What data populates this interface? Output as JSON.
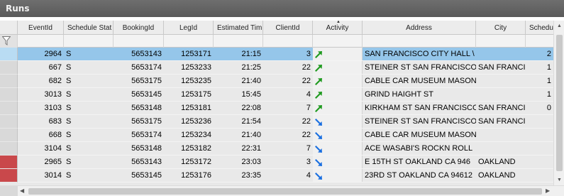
{
  "window": {
    "title": "Runs"
  },
  "columns": [
    {
      "key": "eventid",
      "label": "EventId"
    },
    {
      "key": "status",
      "label": "Schedule Stat"
    },
    {
      "key": "booking",
      "label": "BookingId"
    },
    {
      "key": "leg",
      "label": "LegId"
    },
    {
      "key": "time",
      "label": "Estimated Tim"
    },
    {
      "key": "client",
      "label": "ClientId"
    },
    {
      "key": "activity",
      "label": "Activity"
    },
    {
      "key": "address",
      "label": "Address"
    },
    {
      "key": "city",
      "label": "City"
    },
    {
      "key": "sched",
      "label": "Schedu"
    }
  ],
  "colors": {
    "pickup_arrow": "#1f9a1f",
    "dropoff_arrow": "#1a6fe0",
    "selected_row": "#95c6ea",
    "flag_red": "#c9484b"
  },
  "rows": [
    {
      "eventid": "2964",
      "status": "S",
      "booking": "5653143",
      "leg": "1253171",
      "time": "21:15",
      "client": "3",
      "activity": "pickup-arrow-icon",
      "address": "SAN FRANCISCO CITY HALL \\",
      "city": "",
      "sched": "2",
      "selected": true,
      "flag": "selected"
    },
    {
      "eventid": "667",
      "status": "S",
      "booking": "5653174",
      "leg": "1253233",
      "time": "21:25",
      "client": "22",
      "activity": "pickup-arrow-icon",
      "address": "STEINER ST SAN FRANCISCO",
      "city": "SAN FRANCI",
      "sched": "1",
      "selected": false,
      "flag": "none"
    },
    {
      "eventid": "682",
      "status": "S",
      "booking": "5653175",
      "leg": "1253235",
      "time": "21:40",
      "client": "22",
      "activity": "pickup-arrow-icon",
      "address": "CABLE CAR MUSEUM MASON",
      "city": "",
      "sched": "1",
      "selected": false,
      "flag": "none"
    },
    {
      "eventid": "3013",
      "status": "S",
      "booking": "5653145",
      "leg": "1253175",
      "time": "15:45",
      "client": "4",
      "activity": "pickup-arrow-icon",
      "address": "GRIND HAIGHT ST",
      "city": "",
      "sched": "1",
      "selected": false,
      "flag": "none"
    },
    {
      "eventid": "3103",
      "status": "S",
      "booking": "5653148",
      "leg": "1253181",
      "time": "22:08",
      "client": "7",
      "activity": "pickup-arrow-icon",
      "address": "KIRKHAM ST SAN FRANCISCO",
      "city": "SAN FRANCI",
      "sched": "0",
      "selected": false,
      "flag": "none"
    },
    {
      "eventid": "683",
      "status": "S",
      "booking": "5653175",
      "leg": "1253236",
      "time": "21:54",
      "client": "22",
      "activity": "dropoff-arrow-icon",
      "address": "STEINER ST SAN FRANCISCO",
      "city": "SAN FRANCI",
      "sched": "",
      "selected": false,
      "flag": "none"
    },
    {
      "eventid": "668",
      "status": "S",
      "booking": "5653174",
      "leg": "1253234",
      "time": "21:40",
      "client": "22",
      "activity": "dropoff-arrow-icon",
      "address": "CABLE CAR MUSEUM MASON",
      "city": "",
      "sched": "",
      "selected": false,
      "flag": "none"
    },
    {
      "eventid": "3104",
      "status": "S",
      "booking": "5653148",
      "leg": "1253182",
      "time": "22:31",
      "client": "7",
      "activity": "dropoff-arrow-icon",
      "address": "ACE WASABI'S ROCKN ROLL",
      "city": "",
      "sched": "",
      "selected": false,
      "flag": "none"
    },
    {
      "eventid": "2965",
      "status": "S",
      "booking": "5653143",
      "leg": "1253172",
      "time": "23:03",
      "client": "3",
      "activity": "dropoff-arrow-icon",
      "address": "E 15TH ST OAKLAND CA 946",
      "city": "OAKLAND",
      "sched": "",
      "selected": false,
      "flag": "red"
    },
    {
      "eventid": "3014",
      "status": "S",
      "booking": "5653145",
      "leg": "1253176",
      "time": "23:35",
      "client": "4",
      "activity": "dropoff-arrow-icon",
      "address": "23RD ST OAKLAND CA 94612",
      "city": "OAKLAND",
      "sched": "",
      "selected": false,
      "flag": "red"
    }
  ]
}
